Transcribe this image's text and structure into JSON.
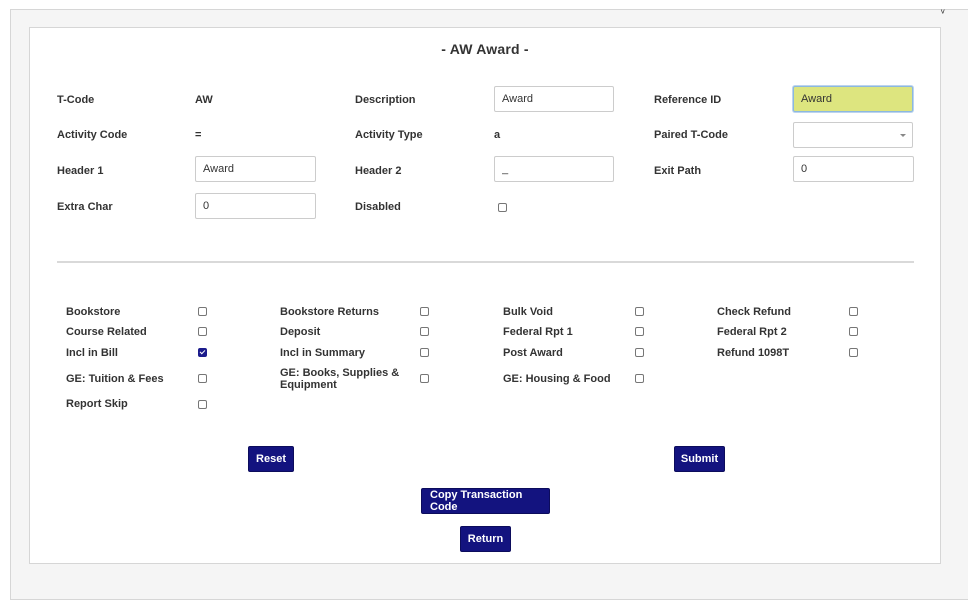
{
  "page_title": "- AW  Award -",
  "corner_glyph": "ᵥ",
  "fields": {
    "tcode": {
      "label": "T-Code",
      "value": "AW"
    },
    "description": {
      "label": "Description",
      "value": "Award"
    },
    "reference_id": {
      "label": "Reference ID",
      "value": "Award"
    },
    "activity_code": {
      "label": "Activity Code",
      "value": "="
    },
    "activity_type": {
      "label": "Activity Type",
      "value": "a"
    },
    "paired_tcode": {
      "label": "Paired T-Code",
      "value": ""
    },
    "header1": {
      "label": "Header 1",
      "value": "Award"
    },
    "header2": {
      "label": "Header 2",
      "value": "_"
    },
    "exit_path": {
      "label": "Exit Path",
      "value": "0"
    },
    "extra_char": {
      "label": "Extra Char",
      "value": "0"
    },
    "disabled": {
      "label": "Disabled",
      "checked": false
    }
  },
  "flags": {
    "bookstore": {
      "label": "Bookstore",
      "checked": false
    },
    "bookstore_returns": {
      "label": "Bookstore Returns",
      "checked": false
    },
    "bulk_void": {
      "label": "Bulk Void",
      "checked": false
    },
    "check_refund": {
      "label": "Check Refund",
      "checked": false
    },
    "course_related": {
      "label": "Course Related",
      "checked": false
    },
    "deposit": {
      "label": "Deposit",
      "checked": false
    },
    "federal_rpt1": {
      "label": "Federal Rpt 1",
      "checked": false
    },
    "federal_rpt2": {
      "label": "Federal Rpt 2",
      "checked": false
    },
    "incl_in_bill": {
      "label": "Incl in Bill",
      "checked": true
    },
    "incl_in_summary": {
      "label": "Incl in Summary",
      "checked": false
    },
    "post_award": {
      "label": "Post Award",
      "checked": false
    },
    "refund_1098t": {
      "label": "Refund 1098T",
      "checked": false
    },
    "ge_tuition": {
      "label": "GE: Tuition & Fees",
      "checked": false
    },
    "ge_books": {
      "label": "GE: Books, Supplies & Equipment",
      "checked": false
    },
    "ge_housing": {
      "label": "GE: Housing & Food",
      "checked": false
    },
    "report_skip": {
      "label": "Report Skip",
      "checked": false
    }
  },
  "buttons": {
    "reset": "Reset",
    "submit": "Submit",
    "copy": "Copy Transaction Code",
    "return": "Return"
  },
  "colors": {
    "button_bg": "#13137f",
    "highlight_field": "#dde57f",
    "checkbox_checked": "#1c1c8c"
  }
}
